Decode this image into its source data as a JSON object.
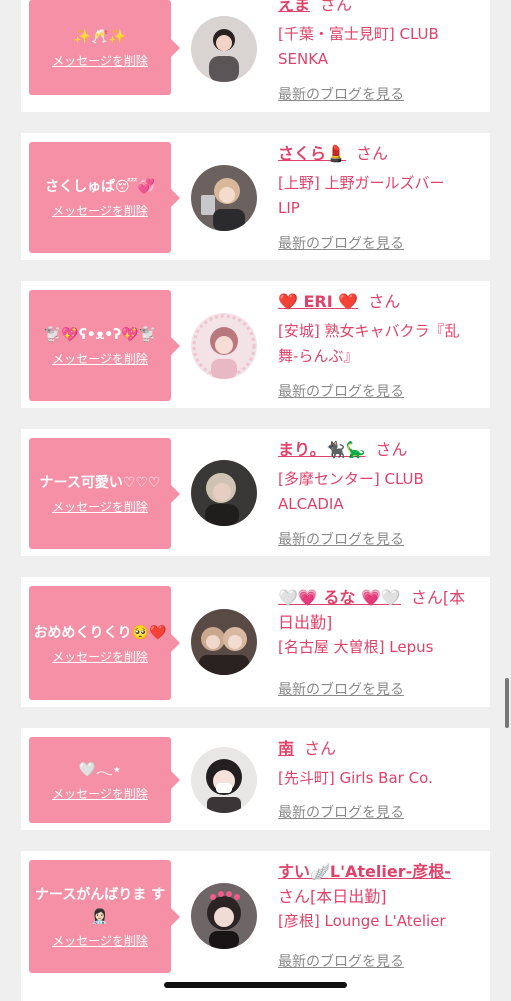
{
  "common": {
    "delete_label": "メッセージを削除",
    "blog_label": "最新のブログを見る",
    "san": "さん"
  },
  "cards": [
    {
      "message": "✨🥂✨",
      "name": "えま",
      "san_suffix": "さん",
      "shop_lines": [
        "[千葉・富士見町] CLUB",
        "SENKA"
      ]
    },
    {
      "message": "さくしゅぱ😴💞",
      "name": "さくら💄",
      "san_suffix": "さん",
      "shop_lines": [
        "[上野] 上野ガールズバー",
        "LIP"
      ]
    },
    {
      "message": "🐩💖ʕ•ᴥ•ʔ💖🐩",
      "name": "❤️ ERI ❤️",
      "san_suffix": "さん",
      "shop_lines": [
        "[安城] 熟女キャバクラ『乱",
        "舞-らんぶ』"
      ]
    },
    {
      "message": "ナース可愛い♡♡♡",
      "name": "まり。🐈‍⬛🦕",
      "san_suffix": "さん",
      "shop_lines": [
        "[多摩センター] CLUB",
        "ALCADIA"
      ]
    },
    {
      "message": "おめめくりくり🥺❤️",
      "name": "🤍💗 るな 💗🤍",
      "san_suffix": "さん[本",
      "name_line2": "日出勤]",
      "shop_lines": [
        "[名古屋 大曽根] Lepus"
      ]
    },
    {
      "message": "🤍𓂃⋆",
      "name": "南",
      "san_suffix": "さん",
      "shop_lines": [
        "[先斗町] Girls Bar Co."
      ]
    },
    {
      "message": "ナースがんばりま す👩🏻‍⚕️",
      "name": "すい🪽L'Atelier-彦根-",
      "name_line2": "さん[本日出勤]",
      "shop_lines": [
        "[彦根] Lounge L'Atelier"
      ]
    }
  ],
  "colors": {
    "bubble": "#f690a6",
    "accent": "#e0436a",
    "link_gray": "#8a8a8a",
    "background": "#efefef"
  }
}
